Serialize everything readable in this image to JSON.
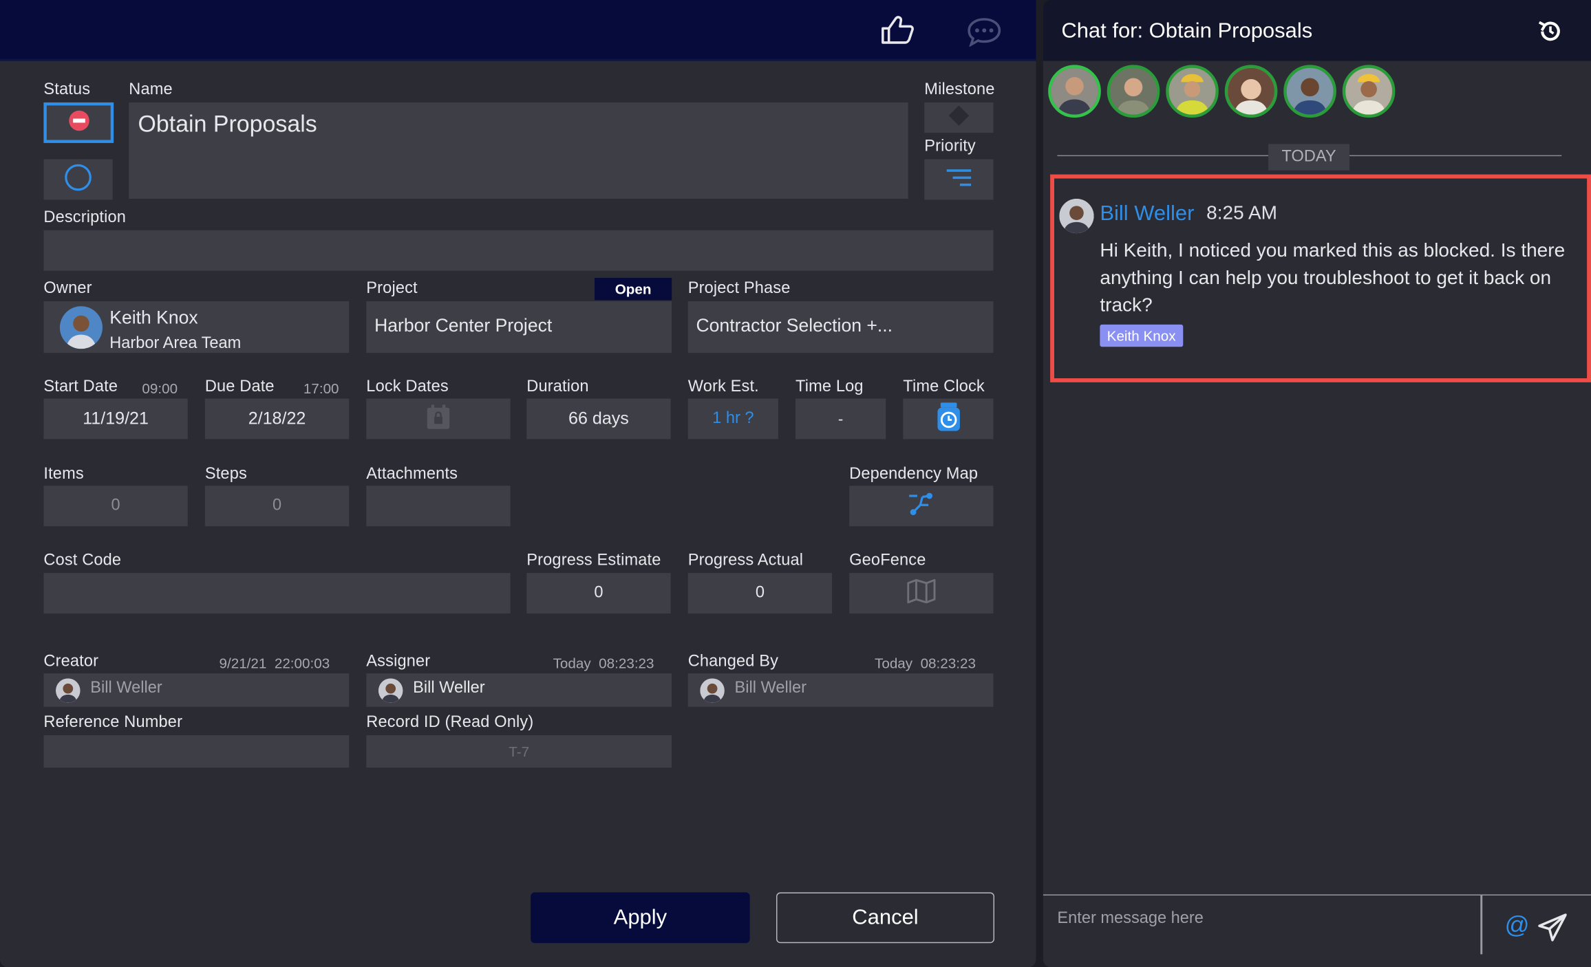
{
  "task": {
    "status_label": "Status",
    "name_label": "Name",
    "name_value": "Obtain Proposals",
    "milestone_label": "Milestone",
    "priority_label": "Priority",
    "description_label": "Description",
    "owner_label": "Owner",
    "owner_name": "Keith Knox",
    "owner_team": "Harbor Area Team",
    "project_label": "Project",
    "project_badge": "Open",
    "project_value": "Harbor Center Project",
    "phase_label": "Project Phase",
    "phase_value": "Contractor Selection +...",
    "start_label": "Start Date",
    "start_time": "09:00",
    "start_value": "11/19/21",
    "due_label": "Due Date",
    "due_time": "17:00",
    "due_value": "2/18/22",
    "lock_label": "Lock Dates",
    "duration_label": "Duration",
    "duration_value": "66 days",
    "workest_label": "Work Est.",
    "workest_value": "1 hr ?",
    "timelog_label": "Time Log",
    "timelog_value": "-",
    "timeclock_label": "Time Clock",
    "items_label": "Items",
    "items_value": "0",
    "steps_label": "Steps",
    "steps_value": "0",
    "attachments_label": "Attachments",
    "depmap_label": "Dependency Map",
    "costcode_label": "Cost Code",
    "progest_label": "Progress Estimate",
    "progest_value": "0",
    "progact_label": "Progress Actual",
    "progact_value": "0",
    "geofence_label": "GeoFence",
    "creator_label": "Creator",
    "creator_time": "9/21/21  22:00:03",
    "creator_value": "Bill Weller",
    "assigner_label": "Assigner",
    "assigner_time": "Today  08:23:23",
    "assigner_value": "Bill Weller",
    "changedby_label": "Changed By",
    "changedby_time": "Today  08:23:23",
    "changedby_value": "Bill Weller",
    "refnum_label": "Reference Number",
    "recordid_label": "Record ID (Read Only)",
    "recordid_value": "T-7"
  },
  "buttons": {
    "apply": "Apply",
    "cancel": "Cancel"
  },
  "chat": {
    "title": "Chat for: Obtain Proposals",
    "divider": "TODAY",
    "message": {
      "author": "Bill Weller",
      "time": "8:25 AM",
      "text": "Hi Keith, I noticed you marked this as blocked. Is there anything I can help you troubleshoot to get it back on track?",
      "mention": "Keith Knox"
    },
    "input_placeholder": "Enter message here",
    "at_symbol": "@"
  },
  "icons": {
    "header": [
      "thumbs-up-icon",
      "chat-bubble-icon"
    ],
    "chat_header": [
      "history-icon"
    ],
    "fields": [
      "blocked-status-icon",
      "open-status-icon",
      "milestone-diamond-icon",
      "priority-icon",
      "calendar-lock-icon",
      "time-clock-icon",
      "dependency-map-icon",
      "map-icon"
    ],
    "chat_input": [
      "mention-icon",
      "send-icon"
    ]
  },
  "colors": {
    "header_navy": "#060b3b",
    "accent_blue": "#2e8ee8",
    "blocked_red": "#e84a5f",
    "highlight_red": "#ee4d47",
    "mention_purple": "#8a8ff2",
    "avatar_ring_green": "#2b9c3a"
  }
}
